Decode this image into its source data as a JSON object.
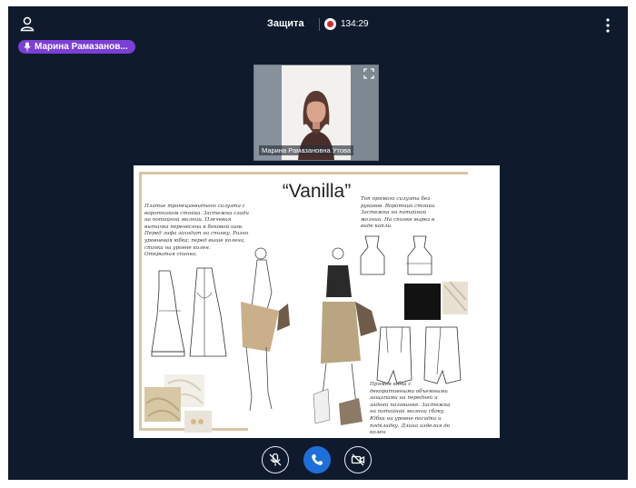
{
  "header": {
    "title": "Защита",
    "timer": "134:29"
  },
  "speaker": {
    "name": "Марина Рамазанов..."
  },
  "video": {
    "participant_name": "Марина Рамазановна Утова"
  },
  "slide": {
    "title": "“Vanilla”",
    "notes": [
      [
        "Платье трапециевидного силуэта с",
        "воротником стойка. Застежка сзади",
        "на потайной молнии. Плечевая",
        "вытачка перенесена в боковой шов.",
        "Перед лифа заходит на спинку. Разно",
        "уровневая юбка: перед выше колена,",
        "спинка на уровне колен.",
        "Открытая спинка."
      ],
      [
        "Топ прямого силуэта без",
        "рукавов. Воротник стойка.",
        "Застежка на потайной",
        "молнии. На спинке вырез в",
        "виде капли."
      ],
      [
        "Прямая юбка с",
        "декоративными объемными",
        "защипами на передней и",
        "задней половинке. Застежка",
        "на потайной молнии сбоку.",
        "Юбка на уровне посадка и",
        "подкладку. Длина изделия до",
        "колен"
      ]
    ]
  },
  "controls": {
    "mic": "mic-off",
    "call": "end-call",
    "camera": "camera-off"
  },
  "colors": {
    "background": "#0f1b2d",
    "speaker_badge": "#7b3fd6",
    "record": "#d9262a",
    "call_button": "#1e6fd9"
  }
}
